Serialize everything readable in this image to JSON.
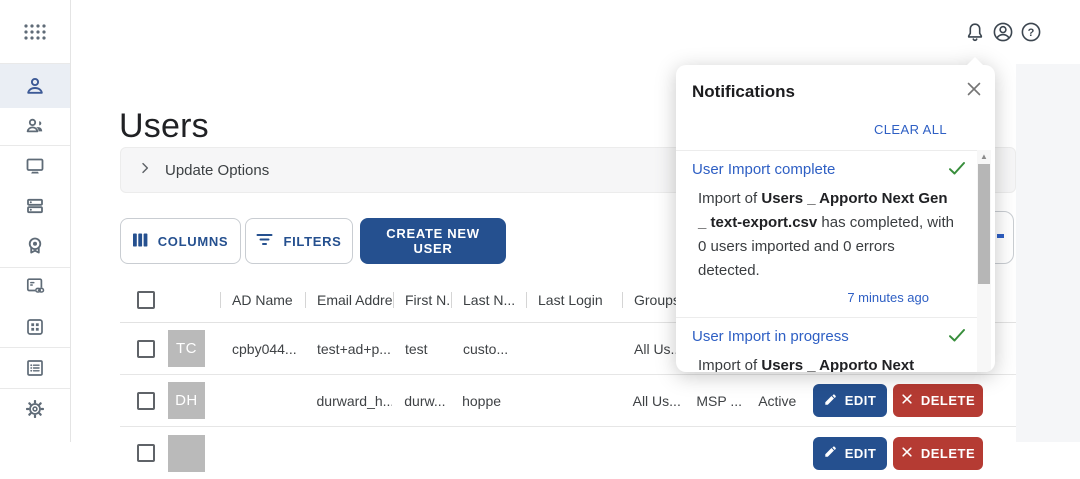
{
  "colors": {
    "primary_navy": "#25508f",
    "danger_red": "#b53b33",
    "link_blue": "#2e5fc4",
    "success_green": "#388e3c",
    "sidebar_active_bg": "#eaeef4"
  },
  "topbar": {
    "icons": [
      {
        "name": "bell-icon"
      },
      {
        "name": "account-icon"
      },
      {
        "name": "help-icon"
      }
    ]
  },
  "sidebar": {
    "items": [
      {
        "icon": "apps-grid-icon",
        "active": false
      },
      {
        "icon": "user-icon",
        "active": true
      },
      {
        "icon": "users-group-icon",
        "active": false
      },
      {
        "icon": "desktop-icon",
        "active": false
      },
      {
        "icon": "server-icon",
        "active": false
      },
      {
        "icon": "webcam-icon",
        "active": false
      },
      {
        "icon": "card-link-icon",
        "active": false
      },
      {
        "icon": "grid-squares-icon",
        "active": false
      },
      {
        "icon": "list-icon",
        "active": false
      },
      {
        "icon": "settings-gear-icon",
        "active": false
      }
    ]
  },
  "page": {
    "title": "Users",
    "update_options_label": "Update Options"
  },
  "toolbar": {
    "columns_label": "COLUMNS",
    "filters_label": "FILTERS",
    "create_user_label": "CREATE NEW USER"
  },
  "table": {
    "headers": {
      "ad_name": "AD Name",
      "email": "Email Addre...",
      "first_name": "First N...",
      "last_name": "Last N...",
      "last_login": "Last Login",
      "groups": "Groups"
    },
    "actions": {
      "edit_label": "EDIT",
      "delete_label": "DELETE"
    },
    "rows": [
      {
        "initials": "TC",
        "ad_name": "cpby044...",
        "email": "test+ad+p...",
        "first_name": "test",
        "last_name": "custo...",
        "last_login": "",
        "groups": "All Us..",
        "extra1": "",
        "extra2": ""
      },
      {
        "initials": "DH",
        "ad_name": "",
        "email": "durward_h...",
        "first_name": "durw...",
        "last_name": "hoppe",
        "last_login": "",
        "groups": "All Us...",
        "extra1": "MSP ...",
        "extra2": "Active"
      },
      {
        "initials": "",
        "ad_name": "",
        "email": "",
        "first_name": "",
        "last_name": "",
        "last_login": "",
        "groups": "",
        "extra1": "",
        "extra2": ""
      }
    ]
  },
  "notifications": {
    "title": "Notifications",
    "clear_all_label": "CLEAR ALL",
    "items": [
      {
        "title": "User Import complete",
        "body_prefix": "Import of ",
        "body_bold": "Users _ Apporto Next Gen _ text-export.csv",
        "body_suffix": " has completed, with 0 users imported and 0 errors detected.",
        "timestamp": "7 minutes ago"
      },
      {
        "title": "User Import in progress",
        "body_prefix": "Import of ",
        "body_bold": "Users _ Apporto Next",
        "body_suffix": "",
        "timestamp": ""
      }
    ]
  }
}
